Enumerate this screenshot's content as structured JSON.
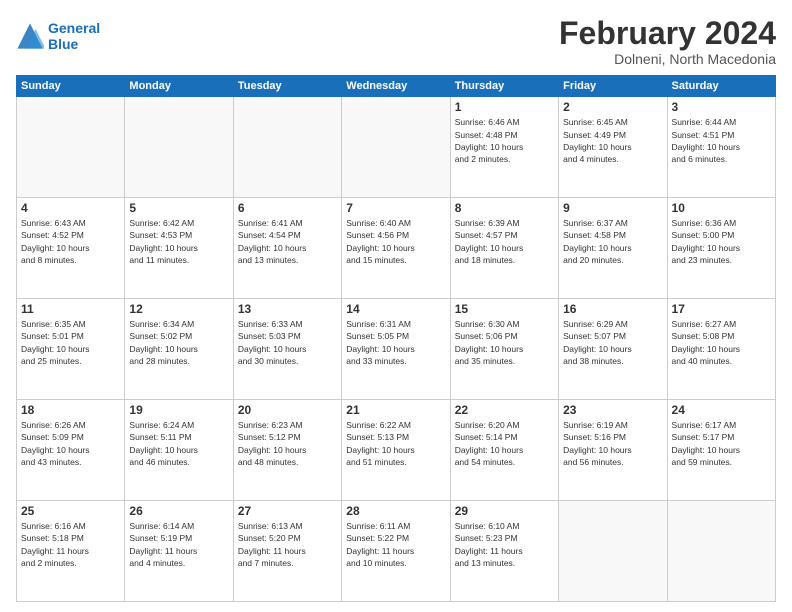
{
  "header": {
    "logo_line1": "General",
    "logo_line2": "Blue",
    "month": "February 2024",
    "location": "Dolneni, North Macedonia"
  },
  "weekdays": [
    "Sunday",
    "Monday",
    "Tuesday",
    "Wednesday",
    "Thursday",
    "Friday",
    "Saturday"
  ],
  "weeks": [
    [
      {
        "day": "",
        "info": ""
      },
      {
        "day": "",
        "info": ""
      },
      {
        "day": "",
        "info": ""
      },
      {
        "day": "",
        "info": ""
      },
      {
        "day": "1",
        "info": "Sunrise: 6:46 AM\nSunset: 4:48 PM\nDaylight: 10 hours\nand 2 minutes."
      },
      {
        "day": "2",
        "info": "Sunrise: 6:45 AM\nSunset: 4:49 PM\nDaylight: 10 hours\nand 4 minutes."
      },
      {
        "day": "3",
        "info": "Sunrise: 6:44 AM\nSunset: 4:51 PM\nDaylight: 10 hours\nand 6 minutes."
      }
    ],
    [
      {
        "day": "4",
        "info": "Sunrise: 6:43 AM\nSunset: 4:52 PM\nDaylight: 10 hours\nand 8 minutes."
      },
      {
        "day": "5",
        "info": "Sunrise: 6:42 AM\nSunset: 4:53 PM\nDaylight: 10 hours\nand 11 minutes."
      },
      {
        "day": "6",
        "info": "Sunrise: 6:41 AM\nSunset: 4:54 PM\nDaylight: 10 hours\nand 13 minutes."
      },
      {
        "day": "7",
        "info": "Sunrise: 6:40 AM\nSunset: 4:56 PM\nDaylight: 10 hours\nand 15 minutes."
      },
      {
        "day": "8",
        "info": "Sunrise: 6:39 AM\nSunset: 4:57 PM\nDaylight: 10 hours\nand 18 minutes."
      },
      {
        "day": "9",
        "info": "Sunrise: 6:37 AM\nSunset: 4:58 PM\nDaylight: 10 hours\nand 20 minutes."
      },
      {
        "day": "10",
        "info": "Sunrise: 6:36 AM\nSunset: 5:00 PM\nDaylight: 10 hours\nand 23 minutes."
      }
    ],
    [
      {
        "day": "11",
        "info": "Sunrise: 6:35 AM\nSunset: 5:01 PM\nDaylight: 10 hours\nand 25 minutes."
      },
      {
        "day": "12",
        "info": "Sunrise: 6:34 AM\nSunset: 5:02 PM\nDaylight: 10 hours\nand 28 minutes."
      },
      {
        "day": "13",
        "info": "Sunrise: 6:33 AM\nSunset: 5:03 PM\nDaylight: 10 hours\nand 30 minutes."
      },
      {
        "day": "14",
        "info": "Sunrise: 6:31 AM\nSunset: 5:05 PM\nDaylight: 10 hours\nand 33 minutes."
      },
      {
        "day": "15",
        "info": "Sunrise: 6:30 AM\nSunset: 5:06 PM\nDaylight: 10 hours\nand 35 minutes."
      },
      {
        "day": "16",
        "info": "Sunrise: 6:29 AM\nSunset: 5:07 PM\nDaylight: 10 hours\nand 38 minutes."
      },
      {
        "day": "17",
        "info": "Sunrise: 6:27 AM\nSunset: 5:08 PM\nDaylight: 10 hours\nand 40 minutes."
      }
    ],
    [
      {
        "day": "18",
        "info": "Sunrise: 6:26 AM\nSunset: 5:09 PM\nDaylight: 10 hours\nand 43 minutes."
      },
      {
        "day": "19",
        "info": "Sunrise: 6:24 AM\nSunset: 5:11 PM\nDaylight: 10 hours\nand 46 minutes."
      },
      {
        "day": "20",
        "info": "Sunrise: 6:23 AM\nSunset: 5:12 PM\nDaylight: 10 hours\nand 48 minutes."
      },
      {
        "day": "21",
        "info": "Sunrise: 6:22 AM\nSunset: 5:13 PM\nDaylight: 10 hours\nand 51 minutes."
      },
      {
        "day": "22",
        "info": "Sunrise: 6:20 AM\nSunset: 5:14 PM\nDaylight: 10 hours\nand 54 minutes."
      },
      {
        "day": "23",
        "info": "Sunrise: 6:19 AM\nSunset: 5:16 PM\nDaylight: 10 hours\nand 56 minutes."
      },
      {
        "day": "24",
        "info": "Sunrise: 6:17 AM\nSunset: 5:17 PM\nDaylight: 10 hours\nand 59 minutes."
      }
    ],
    [
      {
        "day": "25",
        "info": "Sunrise: 6:16 AM\nSunset: 5:18 PM\nDaylight: 11 hours\nand 2 minutes."
      },
      {
        "day": "26",
        "info": "Sunrise: 6:14 AM\nSunset: 5:19 PM\nDaylight: 11 hours\nand 4 minutes."
      },
      {
        "day": "27",
        "info": "Sunrise: 6:13 AM\nSunset: 5:20 PM\nDaylight: 11 hours\nand 7 minutes."
      },
      {
        "day": "28",
        "info": "Sunrise: 6:11 AM\nSunset: 5:22 PM\nDaylight: 11 hours\nand 10 minutes."
      },
      {
        "day": "29",
        "info": "Sunrise: 6:10 AM\nSunset: 5:23 PM\nDaylight: 11 hours\nand 13 minutes."
      },
      {
        "day": "",
        "info": ""
      },
      {
        "day": "",
        "info": ""
      }
    ]
  ]
}
